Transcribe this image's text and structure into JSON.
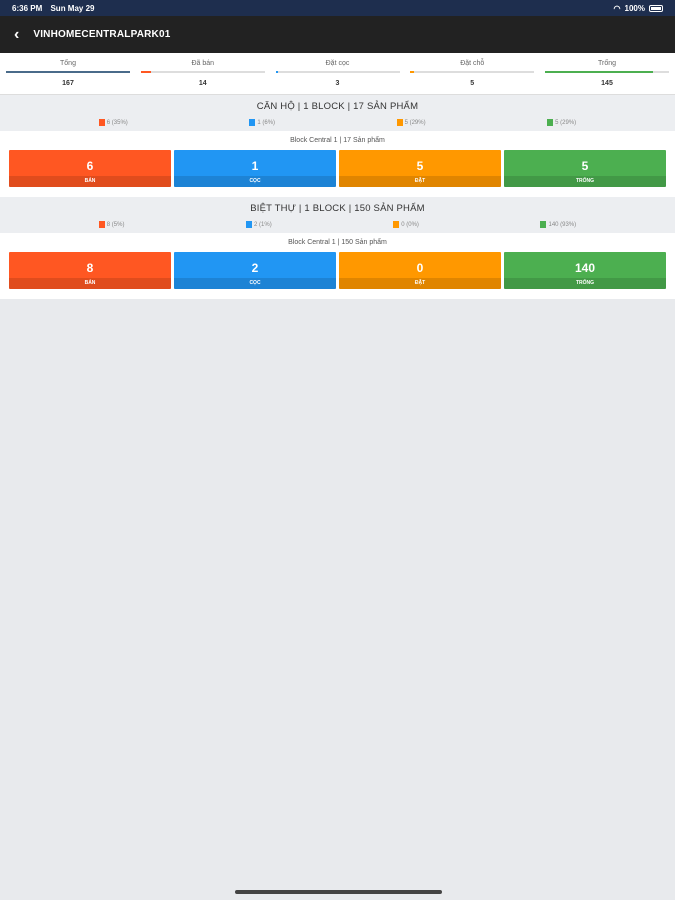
{
  "status": {
    "time": "6:36 PM",
    "date": "Sun May 29",
    "battery": "100%"
  },
  "nav": {
    "title": "VINHOMECENTRALPARK01"
  },
  "tabs": [
    {
      "label": "Tổng",
      "value": "167",
      "color": "#4a6b8a",
      "fill": 1.0
    },
    {
      "label": "Đã bán",
      "value": "14",
      "color": "#ff5722",
      "fill": 0.08
    },
    {
      "label": "Đặt cọc",
      "value": "3",
      "color": "#2196f3",
      "fill": 0.02
    },
    {
      "label": "Đặt chỗ",
      "value": "5",
      "color": "#ff9800",
      "fill": 0.03
    },
    {
      "label": "Trống",
      "value": "145",
      "color": "#4caf50",
      "fill": 0.87
    }
  ],
  "sections": [
    {
      "title": "CĂN HỘ | 1 BLOCK | 17 SẢN PHẨM",
      "legend": [
        "6 (35%)",
        "1 (6%)",
        "5 (29%)",
        "5 (29%)"
      ],
      "block_title": "Block Central 1 | 17 Sản phẩm",
      "tiles": [
        {
          "num": "6",
          "label": "BÁN"
        },
        {
          "num": "1",
          "label": "CỌC"
        },
        {
          "num": "5",
          "label": "ĐẶT"
        },
        {
          "num": "5",
          "label": "TRỐNG"
        }
      ]
    },
    {
      "title": "BIỆT THỰ | 1 BLOCK | 150 SẢN PHẨM",
      "legend": [
        "8 (5%)",
        "2 (1%)",
        "0 (0%)",
        "140 (93%)"
      ],
      "block_title": "Block Central 1 | 150 Sản phẩm",
      "tiles": [
        {
          "num": "8",
          "label": "BÁN"
        },
        {
          "num": "2",
          "label": "CỌC"
        },
        {
          "num": "0",
          "label": "ĐẶT"
        },
        {
          "num": "140",
          "label": "TRỐNG"
        }
      ]
    }
  ],
  "colors": {
    "sold": "#ff5722",
    "deposit": "#2196f3",
    "reserved": "#ff9800",
    "available": "#4caf50"
  }
}
